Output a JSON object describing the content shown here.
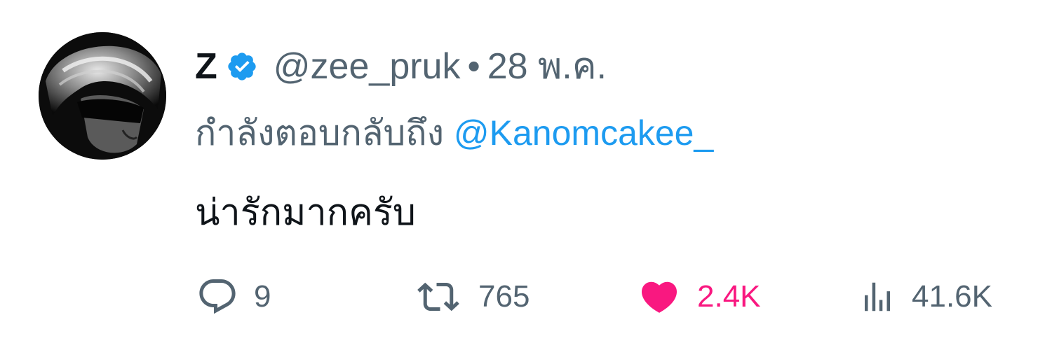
{
  "tweet": {
    "author": {
      "display_name": "Z",
      "handle": "@zee_pruk",
      "verified": true
    },
    "separator": "•",
    "date": "28 พ.ค.",
    "replying_prefix": "กำลังตอบกลับถึง",
    "replying_to": "@Kanomcakee_",
    "text": "น่ารักมากครับ"
  },
  "actions": {
    "replies": "9",
    "retweets": "765",
    "likes": "2.4K",
    "views": "41.6K"
  },
  "colors": {
    "text_primary": "#0f1419",
    "text_secondary": "#536471",
    "link": "#1d9bf0",
    "like": "#f91880",
    "verified": "#1d9bf0"
  },
  "icons": {
    "verified": "verified-badge-icon",
    "reply": "reply-icon",
    "retweet": "retweet-icon",
    "like": "heart-icon",
    "views": "views-icon"
  }
}
